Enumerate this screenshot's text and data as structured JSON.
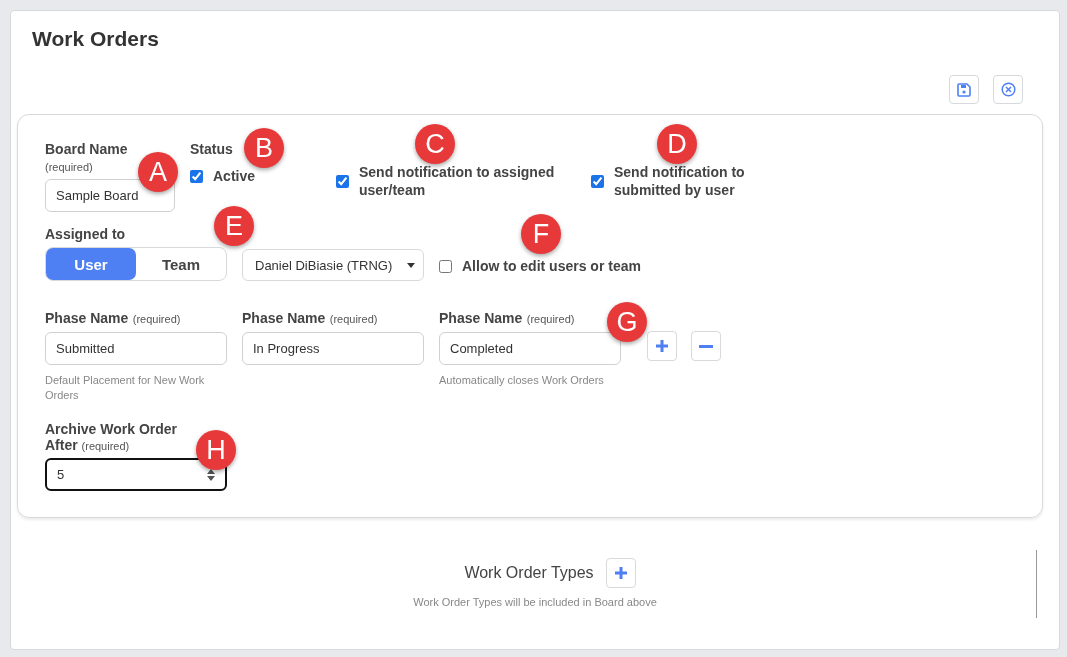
{
  "page": {
    "title": "Work Orders"
  },
  "toolbar": [
    {
      "kind": "save"
    },
    {
      "kind": "cancel"
    }
  ],
  "board_name": {
    "label": "Board Name",
    "hint": "(required)",
    "value": "Sample Board"
  },
  "status": {
    "label": "Status",
    "option": {
      "label": "Active",
      "checked": true
    }
  },
  "notifications": [
    {
      "label": "Send notification to assigned user/team",
      "checked": true
    },
    {
      "label": "Send notification to submitted by user",
      "checked": true
    }
  ],
  "assigned_to": {
    "label": "Assigned to",
    "options": [
      {
        "label": "User",
        "selected": true
      },
      {
        "label": "Team",
        "selected": false
      }
    ],
    "select_value": "Daniel DiBiasie (TRNG)",
    "allow_edit": {
      "label": "Allow to edit users or team",
      "checked": false
    }
  },
  "phases": [
    {
      "label": "Phase Name",
      "hint": "(required)",
      "value": "Submitted",
      "help": "Default Placement for New Work Orders"
    },
    {
      "label": "Phase Name",
      "hint": "(required)",
      "value": "In Progress"
    },
    {
      "label": "Phase Name",
      "hint": "(required)",
      "value": "Completed",
      "help": "Automatically closes Work Orders"
    }
  ],
  "archive": {
    "label": "Archive Work Order After",
    "hint": "(required)",
    "value": "5"
  },
  "work_order_types": {
    "title": "Work Order Types",
    "help": "Work Order Types will be included in Board above"
  },
  "callouts": [
    "A",
    "B",
    "C",
    "D",
    "E",
    "F",
    "G",
    "H"
  ]
}
